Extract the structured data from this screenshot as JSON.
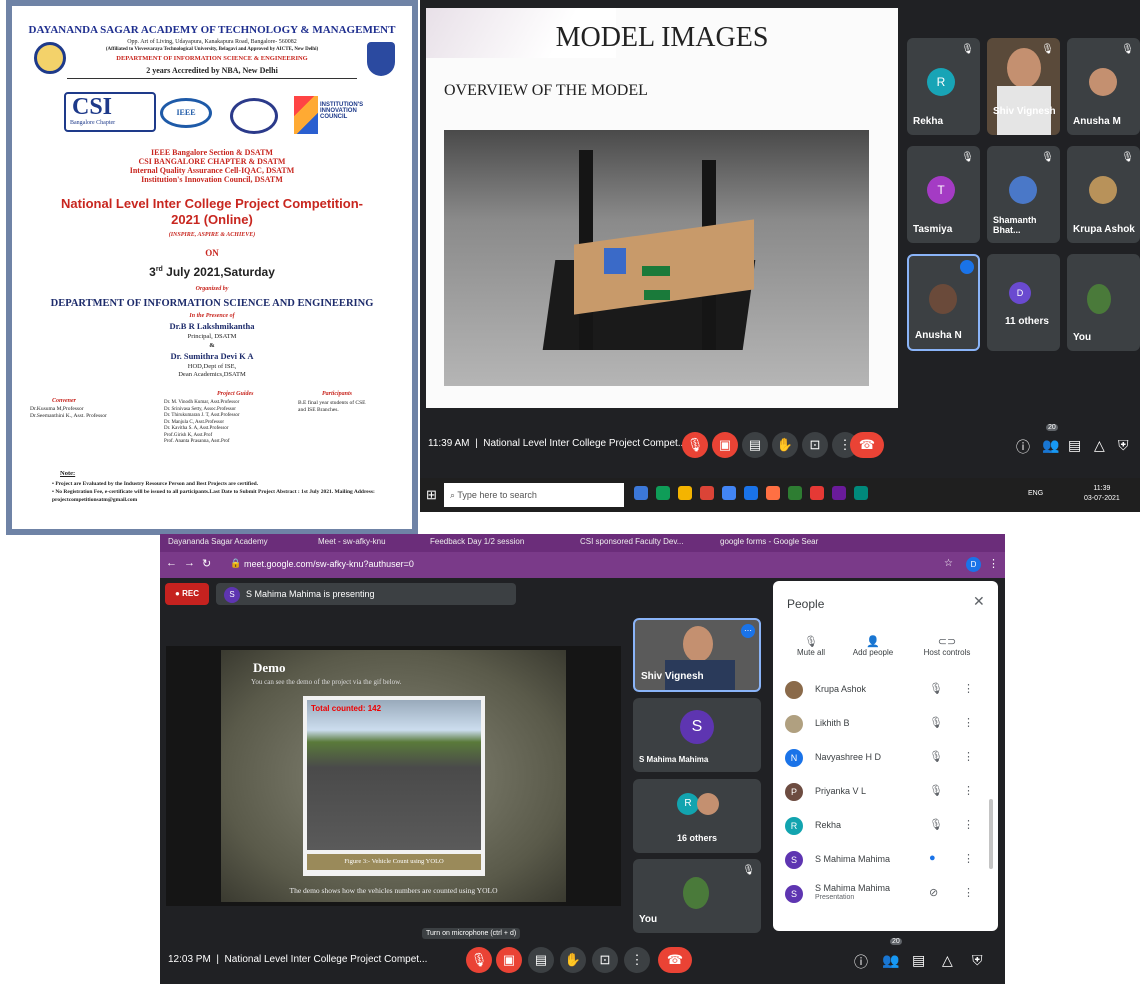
{
  "poster": {
    "institution": "DAYANANDA SAGAR ACADEMY OF TECHNOLOGY & MANAGEMENT",
    "address": "Opp. Art of Living, Udayapura, Kanakapura Road, Bangalore- 560082",
    "affiliation": "(Affiliated to Visvesvaraya Technological University, Belagavi and Approved by AICTE, New Delhi)",
    "department_head": "DEPARTMENT OF INFORMATION SCIENCE & ENGINEERING",
    "accreditation": "2 years Accredited by NBA, New Delhi",
    "logo_csi": "CSI",
    "logo_csi_sub": "Bangalore Chapter",
    "logo_ieee": "IEEE",
    "logo_iic": "INSTITUTION'S INNOVATION COUNCIL",
    "organisers": [
      "IEEE Bangalore Section & DSATM",
      "CSI BANGALORE CHAPTER & DSATM",
      "Internal Quality Assurance Cell-IQAC, DSATM",
      "Institution's Innovation Council, DSATM"
    ],
    "title_line1": "National Level Inter College Project Competition-",
    "title_line2": "2021 (Online)",
    "tagline": "(INSPIRE, ASPIRE & ACHIEVE)",
    "on": "ON",
    "date_day": "3",
    "date_sup": "rd",
    "date_rest": " July 2021,Saturday",
    "organized_by": "Organized by",
    "department": "DEPARTMENT OF INFORMATION SCIENCE AND ENGINEERING",
    "presence": "In the Presence of",
    "principal_name": "Dr.B R Lakshmikantha",
    "principal_role": "Principal, DSATM",
    "amp": "&",
    "hod_name": "Dr. Sumithra Devi K A",
    "hod_role1": "HOD,Dept of ISE,",
    "hod_role2": "Dean Academics,DSATM",
    "convener_head": "Convener",
    "convener_lines": [
      "Dr.Kusuma M,Professor",
      "Dr.Seemanthini K., Asst. Professor"
    ],
    "guides_head": "Project Guides",
    "guides_lines": [
      "Dr. M. Vinodh Kumar, Asst.Professor",
      "Dr. Srinivasa Setty, Assoc.Professor",
      "Dr. Thirukumaran J. T, Asst.Professor",
      "Dr. Manjula C, Asst.Professor",
      "Dr. Kavitha S. A, Asst.Professor",
      "Prof.Girish K, Asst.Prof",
      "Prof. Ananta Prasanna, Asst.Prof"
    ],
    "participants_head": "Participants",
    "participants_lines": [
      "B.E final year students of CSE",
      "and ISE Branches."
    ],
    "note_head": "Note:",
    "notes": [
      "Project are Evaluated by the Industry Resource Person and Best Projects are certified.",
      "No Registration Fee, e-certificate will be issued to all participants.Last Date to Submit Project Abstract : 1st July 2021.   Mailing Address: projectcompetitionsatm@gmail.com"
    ]
  },
  "meet1": {
    "slide_title": "MODEL IMAGES",
    "slide_subtitle": "OVERVIEW OF THE MODEL",
    "participants": [
      {
        "name": "Rekha",
        "initial": "R",
        "color": "#18a4b6"
      },
      {
        "name": "Shiv Vignesh",
        "initial": "",
        "color": "#5a4a3a"
      },
      {
        "name": "Anusha M",
        "initial": "",
        "color": "#7a5a4a"
      },
      {
        "name": "Tasmiya",
        "initial": "T",
        "color": "#a43bc4"
      },
      {
        "name": "Shamanth Bhat...",
        "initial": "",
        "color": "#4a78c8"
      },
      {
        "name": "Krupa Ashok",
        "initial": "",
        "color": "#8a6a4a"
      },
      {
        "name": "Anusha N",
        "initial": "",
        "color": "#6a4a3a"
      },
      {
        "name": "11 others",
        "initial": "D",
        "color": "#6a4ad0"
      },
      {
        "name": "You",
        "initial": "",
        "color": "#4a7a3a"
      }
    ],
    "time": "11:39 AM",
    "meeting_title": "National Level Inter College Project Compet...",
    "badge": "20",
    "taskbar_search": "Type here to search",
    "tray_time": "11:39",
    "tray_date": "03-07-2021",
    "tray_lang": "ENG"
  },
  "meet2": {
    "tabs": [
      "Dayananda Sagar Academy",
      "Meet - sw-afky-knu",
      "Feedback Day 1/2 session",
      "CSI sponsored Faculty Dev...",
      "google forms - Google Sear"
    ],
    "url": "meet.google.com/sw-afky-knu?authuser=0",
    "rec": "REC",
    "presenter_initial": "S",
    "presenting": "S Mahima Mahima is presenting",
    "slide_title": "Demo",
    "slide_text": "You can see the demo of the project via the gif below.",
    "counter": "Total counted: 142",
    "caption": "Figure 3:- Vehicle Count using YOLO",
    "slide_footer": "The demo shows how the vehicles numbers are counted using  YOLO",
    "tile_shiv": "Shiv Vignesh",
    "tile_mahima": "S Mahima Mahima",
    "tile_others": "16 others",
    "tile_you": "You",
    "tooltip": "Turn on microphone (ctrl + d)",
    "time": "12:03 PM",
    "meeting_title": "National Level Inter College Project Compet...",
    "badge": "20",
    "people_title": "People",
    "actions": [
      "Mute all",
      "Add people",
      "Host controls"
    ],
    "people": [
      {
        "name": "Krupa Ashok",
        "initial": "",
        "color": "#8a6a4a",
        "sub": ""
      },
      {
        "name": "Likhith B",
        "initial": "",
        "color": "#b0a080",
        "sub": ""
      },
      {
        "name": "Navyashree H D",
        "initial": "N",
        "color": "#1a73e8",
        "sub": ""
      },
      {
        "name": "Priyanka V L",
        "initial": "P",
        "color": "#6d4c41",
        "sub": ""
      },
      {
        "name": "Rekha",
        "initial": "R",
        "color": "#12a4af",
        "sub": ""
      },
      {
        "name": "S Mahima Mahima",
        "initial": "S",
        "color": "#5e35b1",
        "sub": ""
      },
      {
        "name": "S Mahima Mahima",
        "initial": "S",
        "color": "#5e35b1",
        "sub": "Presentation"
      }
    ]
  }
}
